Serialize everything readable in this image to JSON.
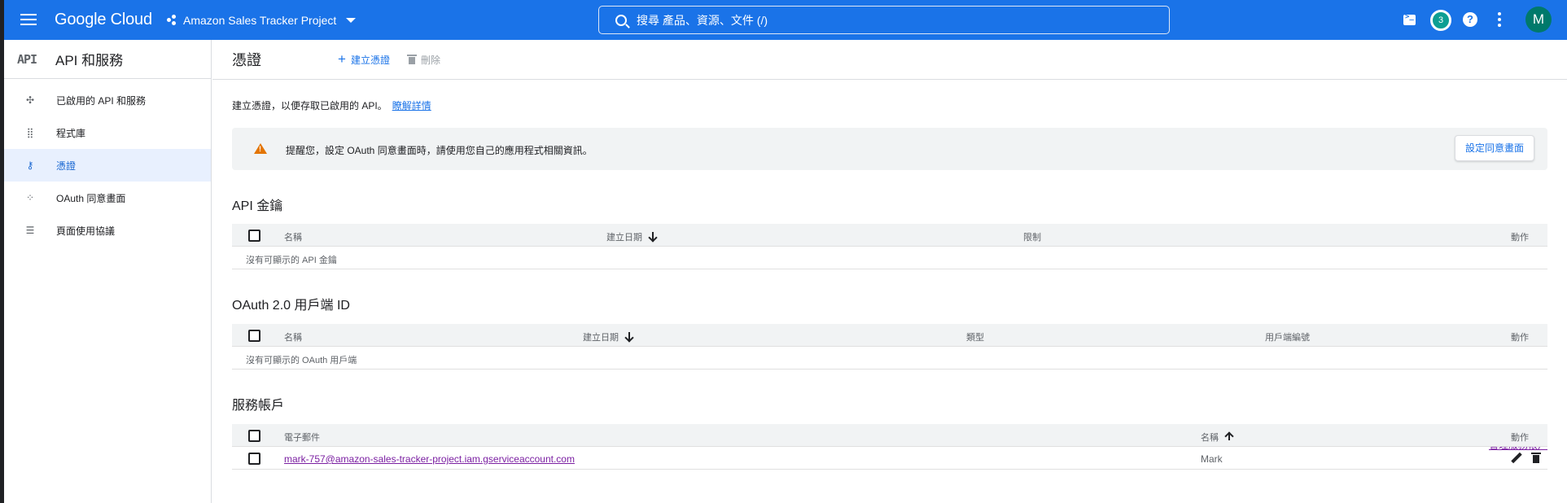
{
  "topbar": {
    "brand": "Google Cloud",
    "project": "Amazon Sales Tracker Project",
    "search_placeholder": "搜尋  產品、資源、文件 (/)",
    "notification_count": "3",
    "avatar_initial": "M",
    "accent_color": "#1a73e8"
  },
  "sidebar": {
    "logo": "API",
    "title": "API 和服務",
    "items": [
      {
        "label": "已啟用的 API 和服務",
        "icon": "api-services-icon"
      },
      {
        "label": "程式庫",
        "icon": "library-icon"
      },
      {
        "label": "憑證",
        "icon": "key-icon",
        "active": true
      },
      {
        "label": "OAuth 同意畫面",
        "icon": "oauth-icon"
      },
      {
        "label": "頁面使用協議",
        "icon": "settings-list-icon"
      }
    ]
  },
  "main": {
    "title": "憑證",
    "create_label": "建立憑證",
    "delete_label": "刪除",
    "intro_text": "建立憑證，以便存取已啟用的 API。",
    "intro_link": "瞭解詳情",
    "banner_text": "提醒您，設定 OAuth 同意畫面時，請使用您自己的應用程式相關資訊。",
    "banner_button": "設定同意畫面",
    "api_keys": {
      "title": "API 金鑰",
      "columns": [
        "名稱",
        "建立日期",
        "限制",
        "動作"
      ],
      "empty": "沒有可顯示的 API 金鑰"
    },
    "oauth": {
      "title": "OAuth 2.0 用戶端 ID",
      "columns": [
        "名稱",
        "建立日期",
        "類型",
        "用戶端編號",
        "動作"
      ],
      "empty": "沒有可顯示的 OAuth 用戶端"
    },
    "service_accounts": {
      "title": "服務帳戶",
      "manage_link": "管理服務帳戶",
      "columns": [
        "電子郵件",
        "名稱",
        "動作"
      ],
      "rows": [
        {
          "email": "mark-757@amazon-sales-tracker-project.iam.gserviceaccount.com",
          "name": "Mark"
        }
      ]
    }
  }
}
